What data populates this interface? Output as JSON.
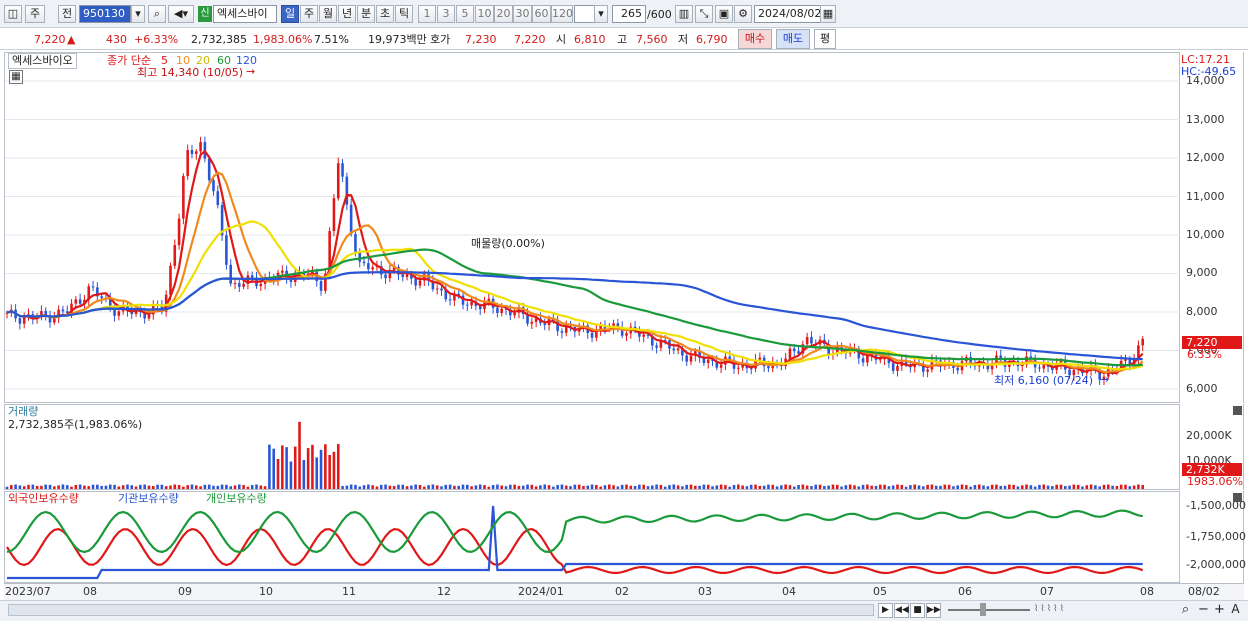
{
  "toolbar": {
    "mode_label": "주",
    "prev_label": "전",
    "code": "950130",
    "new_badge": "신",
    "stock_name": "엑세스바이",
    "periods": [
      "일",
      "주",
      "월",
      "년",
      "분",
      "초",
      "틱"
    ],
    "active_period": "일",
    "intervals": [
      "1",
      "3",
      "5",
      "10",
      "20",
      "30",
      "60",
      "120"
    ],
    "count_value": "265",
    "count_max": "/600",
    "date_value": "2024/08/02"
  },
  "quote": {
    "price": "7,220",
    "change_arrow": "▲",
    "change": "430",
    "change_pct": "+6.33%",
    "volume": "2,732,385",
    "volume_ratio": "1,983.06%",
    "turnover": "7.51%",
    "amount": "19,973백만",
    "hoga_label": "호가",
    "ask": "7,230",
    "bid": "7,220",
    "open_label": "시",
    "open": "6,810",
    "high_label": "고",
    "high": "7,560",
    "low_label": "저",
    "low": "6,790",
    "buy_label": "매수",
    "sell_label": "매도",
    "eval_label": "평"
  },
  "price_pane": {
    "stock_tab": "엑세스바이오",
    "ma_title": "종가 단순",
    "ma_periods": [
      "5",
      "10",
      "20",
      "60",
      "120"
    ],
    "ma_colors": [
      "#e01818",
      "#f08a1c",
      "#f0e000",
      "#1a9a3a",
      "#2a55d6"
    ],
    "max_label": "최고 14,340 (10/05)",
    "min_label": "최저 6,160 (07/24)",
    "midlabel": "매물량(0.00%)",
    "lc": "LC:17.21",
    "hc": "HC:-49.65",
    "yticks": [
      "14,000",
      "13,000",
      "12,000",
      "11,000",
      "10,000",
      "9,000",
      "8,000",
      "7,000",
      "6,000"
    ],
    "last_price_tag": "7,220",
    "last_pct_tag": "6.33%"
  },
  "volume_pane": {
    "title": "거래량",
    "value": "2,732,385주(1,983.06%)",
    "yticks": [
      "20,000K",
      "10,000K"
    ],
    "tag_value": "2,732K",
    "tag_pct": "1983.06%"
  },
  "holdings_pane": {
    "series": [
      "외국인보유수량",
      "기관보유수량",
      "개인보유수량"
    ],
    "colors": [
      "#e01818",
      "#2a55d6",
      "#1a9a3a"
    ],
    "yticks": [
      "-1,500,000",
      "-1,750,000",
      "-2,000,000"
    ]
  },
  "x_axis": {
    "labels": [
      "2023/07",
      "08",
      "09",
      "10",
      "11",
      "12",
      "2024/01",
      "02",
      "03",
      "04",
      "05",
      "06",
      "07",
      "08"
    ],
    "right_label": "08/02"
  }
}
